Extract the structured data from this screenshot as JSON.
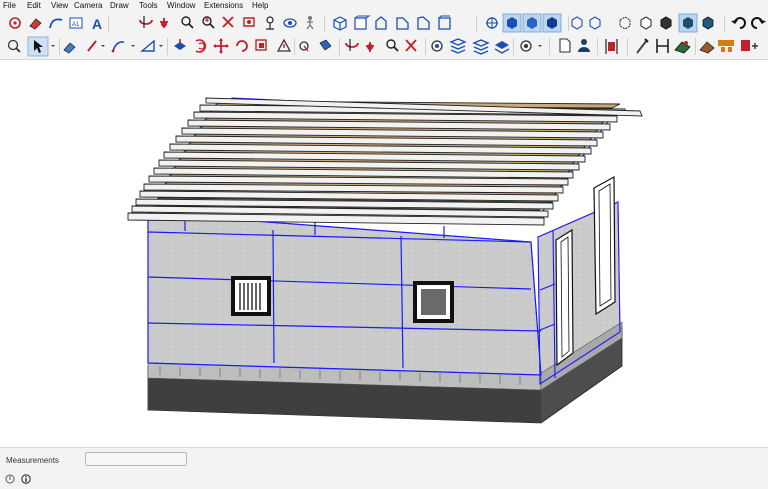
{
  "menu": [
    "File",
    "Edit",
    "View",
    "Camera",
    "Draw",
    "Tools",
    "Window",
    "Extensions",
    "Help"
  ],
  "toolbar_top": [
    "select-icon",
    "eraser-icon",
    "arc-icon",
    "text-icon",
    "3d-text-icon",
    "orbit-icon",
    "pan-icon",
    "zoom-icon",
    "zoom-extents-icon",
    "previous-view-icon",
    "position-camera-icon",
    "look-around-icon",
    "walk-icon",
    "iso-view-icon",
    "top-view-icon",
    "front-view-icon",
    "right-view-icon",
    "back-view-icon",
    "left-view-icon",
    "section-plane-icon",
    "display-section-planes-icon",
    "display-section-cuts-icon",
    "display-section-fill-icon",
    "xray-icon",
    "back-edges-icon",
    "wireframe-icon",
    "hidden-line-icon",
    "shaded-icon",
    "shaded-textures-icon",
    "monochrome-icon",
    "undo-icon",
    "redo-icon"
  ],
  "toolbar_bottom": [
    "zoom-window-icon",
    "select-arrow-icon",
    "eraser-icon",
    "line-icon",
    "arc-icon",
    "rectangle-icon",
    "push-pull-icon",
    "offset-icon",
    "move-icon",
    "rotate-icon",
    "scale-icon",
    "follow-me-icon",
    "tape-measure-icon",
    "paint-bucket-icon",
    "orbit-icon",
    "pan-icon",
    "zoom-icon",
    "zoom-extents-icon",
    "components-icon",
    "warehouse-icon",
    "extension-warehouse-icon",
    "layout-icon",
    "sandbox-icon",
    "styles-icon",
    "new-icon",
    "user-icon",
    "dimensions-icon",
    "protractor-icon",
    "axes-icon",
    "sandbox-from-contours-icon",
    "outliner-icon",
    "entity-info-icon",
    "components-panel-icon"
  ],
  "status_bar": {
    "measurements_label": "Measurements",
    "measurements_value": ""
  },
  "colors": {
    "selection": "#1a1aff",
    "wall": "#c9c9c9",
    "foundation": "#4a4a4a",
    "rafter_top": "#c9a87a",
    "ui_bg": "#f3f3f3"
  }
}
